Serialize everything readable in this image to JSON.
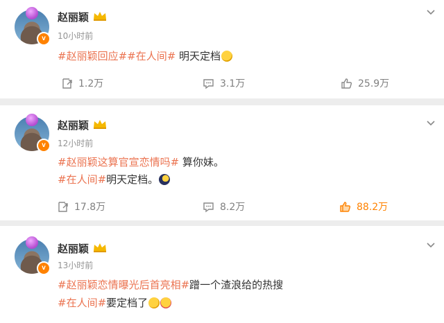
{
  "posts": [
    {
      "username": "赵丽颖",
      "time": "10小时前",
      "lines": [
        {
          "tags": [
            "#赵丽颖回应#",
            "#在人间#"
          ],
          "text": " 明天定档"
        }
      ],
      "actions": {
        "repost": "1.2万",
        "comment": "3.1万",
        "like": "25.9万"
      },
      "liked": false
    },
    {
      "username": "赵丽颖",
      "time": "12小时前",
      "lines": [
        {
          "tags": [
            "#赵丽颖这算官宣恋情吗#"
          ],
          "text": " 算你妹。"
        },
        {
          "tags": [
            "#在人间#"
          ],
          "text": "明天定档。"
        }
      ],
      "actions": {
        "repost": "17.8万",
        "comment": "8.2万",
        "like": "88.2万"
      },
      "liked": true
    },
    {
      "username": "赵丽颖",
      "time": "13小时前",
      "lines": [
        {
          "tags": [
            "#赵丽颖恋情曝光后首亮相#"
          ],
          "text": "蹭一个渣浪给的热搜"
        },
        {
          "tags": [
            "#在人间#"
          ],
          "text": "要定档了"
        }
      ],
      "actions": {
        "repost": "",
        "comment": "",
        "like": ""
      },
      "liked": false
    }
  ],
  "colors": {
    "accent": "#ff8200",
    "tag": "#eb7350",
    "muted": "#939393"
  }
}
